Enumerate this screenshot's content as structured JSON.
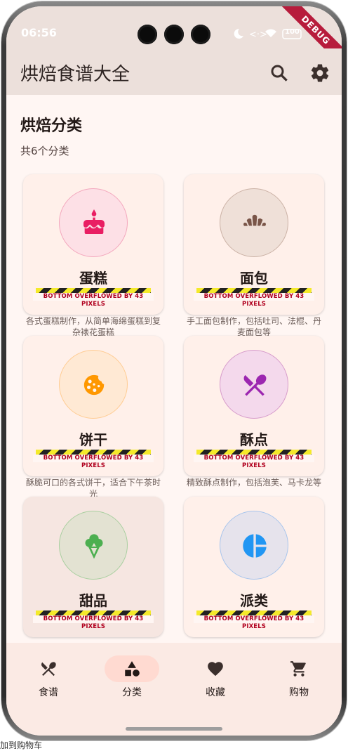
{
  "status": {
    "time": "06:56",
    "battery": "100"
  },
  "debug_banner": "DEBUG",
  "appbar": {
    "title": "烘焙食谱大全",
    "search_icon": "search-icon",
    "settings_icon": "gear-icon"
  },
  "section": {
    "title": "烘焙分类",
    "count_text": "共6个分类"
  },
  "overflow_text": "BOTTOM OVERFLOWED BY 43 PIXELS",
  "categories": [
    {
      "name": "蛋糕",
      "icon": "cake-icon",
      "color": "#e91e63",
      "circle_bg": "#fde0e6",
      "desc": "各式蛋糕制作，从简单海绵蛋糕到复杂裱花蛋糕"
    },
    {
      "name": "面包",
      "icon": "croissant-icon",
      "color": "#795548",
      "circle_bg": "#efe0d8",
      "desc": "手工面包制作，包括吐司、法棍、丹麦面包等"
    },
    {
      "name": "饼干",
      "icon": "cookie-icon",
      "color": "#ff9800",
      "circle_bg": "#ffe9d4",
      "desc": "酥脆可口的各式饼干，适合下午茶时光"
    },
    {
      "name": "酥点",
      "icon": "utensils-icon",
      "color": "#9c27b0",
      "circle_bg": "#f4d9ec",
      "desc": "精致酥点制作，包括泡芙、马卡龙等"
    },
    {
      "name": "甜品",
      "icon": "icecream-icon",
      "color": "#4caf50",
      "circle_bg": "#e3e2d2",
      "desc": ""
    },
    {
      "name": "派类",
      "icon": "pie-icon",
      "color": "#2196f3",
      "circle_bg": "#e6e3ec",
      "desc": ""
    }
  ],
  "nav": [
    {
      "label": "食谱",
      "icon": "utensils-icon",
      "active": false
    },
    {
      "label": "分类",
      "icon": "category-icon",
      "active": true
    },
    {
      "label": "收藏",
      "icon": "heart-icon",
      "active": false
    },
    {
      "label": "购物",
      "icon": "cart-icon",
      "active": false
    }
  ],
  "bottom_partial_text": "加到购物车"
}
